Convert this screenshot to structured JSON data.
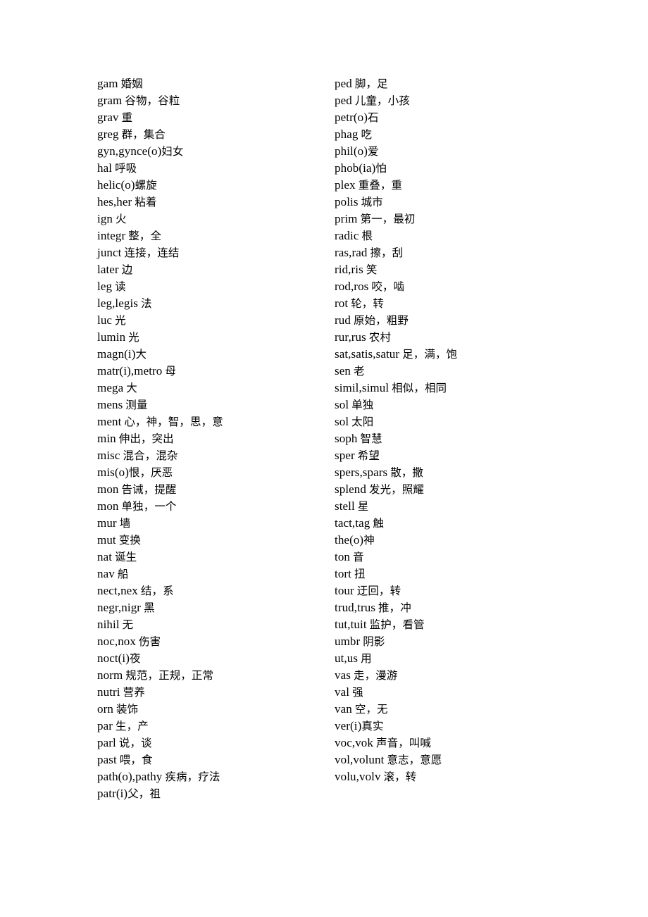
{
  "document": {
    "type": "word-root glossary",
    "layout": "two-column",
    "columns": [
      {
        "id": "left",
        "entries": [
          {
            "root": "gam",
            "space": true,
            "gloss": "婚姻"
          },
          {
            "root": "gram",
            "space": true,
            "gloss": "谷物，谷粒"
          },
          {
            "root": "grav",
            "space": true,
            "gloss": "重"
          },
          {
            "root": "greg",
            "space": true,
            "gloss": "群，集合"
          },
          {
            "root": "gyn,gynce(o)",
            "space": false,
            "gloss": "妇女"
          },
          {
            "root": "hal",
            "space": true,
            "gloss": "呼吸"
          },
          {
            "root": "helic(o)",
            "space": false,
            "gloss": "螺旋"
          },
          {
            "root": "hes,her",
            "space": true,
            "gloss": "粘着"
          },
          {
            "root": "ign",
            "space": true,
            "gloss": "火"
          },
          {
            "root": "integr",
            "space": true,
            "gloss": "整，全"
          },
          {
            "root": "junct",
            "space": true,
            "gloss": "连接，连结"
          },
          {
            "root": "later",
            "space": true,
            "gloss": "边"
          },
          {
            "root": "leg",
            "space": true,
            "gloss": "读"
          },
          {
            "root": "leg,legis",
            "space": true,
            "gloss": "法"
          },
          {
            "root": "luc",
            "space": true,
            "gloss": "光"
          },
          {
            "root": "lumin",
            "space": true,
            "gloss": "光"
          },
          {
            "root": "magn(i)",
            "space": false,
            "gloss": "大"
          },
          {
            "root": "matr(i),metro",
            "space": true,
            "gloss": "母"
          },
          {
            "root": "mega",
            "space": true,
            "gloss": "大"
          },
          {
            "root": "mens",
            "space": true,
            "gloss": "测量"
          },
          {
            "root": "ment",
            "space": true,
            "gloss": "心，神，智，思，意"
          },
          {
            "root": "min",
            "space": true,
            "gloss": "伸出，突出"
          },
          {
            "root": "misc",
            "space": true,
            "gloss": "混合，混杂"
          },
          {
            "root": "mis(o)",
            "space": false,
            "gloss": "恨，厌恶"
          },
          {
            "root": "mon",
            "space": true,
            "gloss": "告诫，提醒"
          },
          {
            "root": "mon",
            "space": true,
            "gloss": "单独，一个"
          },
          {
            "root": "mur",
            "space": true,
            "gloss": "墙"
          },
          {
            "root": "mut",
            "space": true,
            "gloss": "变换"
          },
          {
            "root": "nat",
            "space": true,
            "gloss": "诞生"
          },
          {
            "root": "nav",
            "space": true,
            "gloss": "船"
          },
          {
            "root": "nect,nex",
            "space": true,
            "gloss": "结，系"
          },
          {
            "root": "negr,nigr",
            "space": true,
            "gloss": "黑"
          },
          {
            "root": "nihil",
            "space": true,
            "gloss": "无"
          },
          {
            "root": "noc,nox",
            "space": true,
            "gloss": "伤害"
          },
          {
            "root": "noct(i)",
            "space": false,
            "gloss": "夜"
          },
          {
            "root": "norm",
            "space": true,
            "gloss": "规范，正规，正常"
          },
          {
            "root": "nutri",
            "space": true,
            "gloss": "营养"
          },
          {
            "root": "orn",
            "space": true,
            "gloss": "装饰"
          },
          {
            "root": "par",
            "space": true,
            "gloss": "生，产"
          },
          {
            "root": "parl",
            "space": true,
            "gloss": "说，谈"
          },
          {
            "root": "past",
            "space": true,
            "gloss": "喂，食"
          },
          {
            "root": "path(o),pathy",
            "space": true,
            "gloss": "疾病，疗法"
          },
          {
            "root": "patr(i)",
            "space": false,
            "gloss": "父，祖"
          }
        ]
      },
      {
        "id": "right",
        "entries": [
          {
            "root": "ped",
            "space": true,
            "gloss": "脚，足"
          },
          {
            "root": "ped",
            "space": true,
            "gloss": "儿童，小孩"
          },
          {
            "root": "petr(o)",
            "space": false,
            "gloss": "石"
          },
          {
            "root": "phag",
            "space": true,
            "gloss": "吃"
          },
          {
            "root": "phil(o)",
            "space": false,
            "gloss": "爱"
          },
          {
            "root": "phob(ia)",
            "space": false,
            "gloss": "怕"
          },
          {
            "root": "plex",
            "space": true,
            "gloss": "重叠，重"
          },
          {
            "root": "polis",
            "space": true,
            "gloss": "城市"
          },
          {
            "root": "prim",
            "space": true,
            "gloss": "第一，最初"
          },
          {
            "root": "radic",
            "space": true,
            "gloss": "根"
          },
          {
            "root": "ras,rad",
            "space": true,
            "gloss": "擦，刮"
          },
          {
            "root": "rid,ris",
            "space": true,
            "gloss": "笑"
          },
          {
            "root": "rod,ros",
            "space": true,
            "gloss": "咬，啮"
          },
          {
            "root": "rot",
            "space": true,
            "gloss": "轮，转"
          },
          {
            "root": "rud",
            "space": true,
            "gloss": "原始，粗野"
          },
          {
            "root": "rur,rus",
            "space": true,
            "gloss": "农村"
          },
          {
            "root": "sat,satis,satur",
            "space": true,
            "gloss": "足，满，饱"
          },
          {
            "root": "sen",
            "space": true,
            "gloss": "老"
          },
          {
            "root": "simil,simul",
            "space": true,
            "gloss": "相似，相同"
          },
          {
            "root": "sol",
            "space": true,
            "gloss": "单独"
          },
          {
            "root": "sol",
            "space": true,
            "gloss": "太阳"
          },
          {
            "root": "soph",
            "space": true,
            "gloss": "智慧"
          },
          {
            "root": "sper",
            "space": true,
            "gloss": "希望"
          },
          {
            "root": "spers,spars",
            "space": true,
            "gloss": "散，撒"
          },
          {
            "root": "splend",
            "space": true,
            "gloss": "发光，照耀"
          },
          {
            "root": "stell",
            "space": true,
            "gloss": "星"
          },
          {
            "root": "tact,tag",
            "space": true,
            "gloss": "触"
          },
          {
            "root": "the(o)",
            "space": false,
            "gloss": "神"
          },
          {
            "root": "ton",
            "space": true,
            "gloss": "音"
          },
          {
            "root": "tort",
            "space": true,
            "gloss": "扭"
          },
          {
            "root": "tour",
            "space": true,
            "gloss": "迂回，转"
          },
          {
            "root": "trud,trus",
            "space": true,
            "gloss": "推，冲"
          },
          {
            "root": "tut,tuit",
            "space": true,
            "gloss": "监护，看管"
          },
          {
            "root": "umbr",
            "space": true,
            "gloss": "阴影"
          },
          {
            "root": "ut,us",
            "space": true,
            "gloss": "用"
          },
          {
            "root": "vas",
            "space": true,
            "gloss": "走，漫游"
          },
          {
            "root": "val",
            "space": true,
            "gloss": "强"
          },
          {
            "root": "van",
            "space": true,
            "gloss": "空，无"
          },
          {
            "root": "ver(i)",
            "space": false,
            "gloss": "真实"
          },
          {
            "root": "voc,vok",
            "space": true,
            "gloss": "声音，叫喊"
          },
          {
            "root": "vol,volunt",
            "space": true,
            "gloss": "意志，意愿"
          },
          {
            "root": "volu,volv",
            "space": true,
            "gloss": "滚，转"
          }
        ]
      }
    ]
  }
}
